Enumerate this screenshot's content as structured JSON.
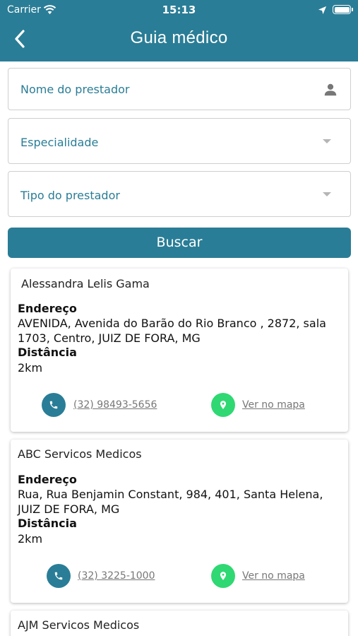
{
  "status_bar": {
    "carrier": "Carrier",
    "time": "15:13"
  },
  "header": {
    "title": "Guia médico"
  },
  "form": {
    "provider_name_placeholder": "Nome do prestador",
    "specialty_placeholder": "Especialidade",
    "provider_type_placeholder": "Tipo do prestador",
    "search_label": "Buscar"
  },
  "labels": {
    "address": "Endereço",
    "distance": "Distância",
    "see_on_map": "Ver no mapa"
  },
  "results": [
    {
      "name": "Alessandra Lelis Gama",
      "address": "AVENIDA, Avenida do Barão do Rio Branco , 2872, sala 1703, Centro, JUIZ DE FORA, MG",
      "distance": "2km",
      "phone": "(32) 98493-5656"
    },
    {
      "name": "ABC Servicos Medicos",
      "address": "Rua, Rua Benjamin Constant, 984, 401, Santa Helena, JUIZ DE FORA, MG",
      "distance": "2km",
      "phone": "(32) 3225-1000"
    },
    {
      "name": "AJM Servicos Medicos"
    }
  ],
  "colors": {
    "primary": "#2a7d96",
    "map_button": "#2fd872",
    "placeholder_text": "#2a7d96"
  },
  "icons": [
    "wifi-icon",
    "location-arrow-icon",
    "battery-icon",
    "back-chevron-icon",
    "person-icon",
    "dropdown-caret-icon",
    "phone-icon",
    "map-pin-icon"
  ]
}
